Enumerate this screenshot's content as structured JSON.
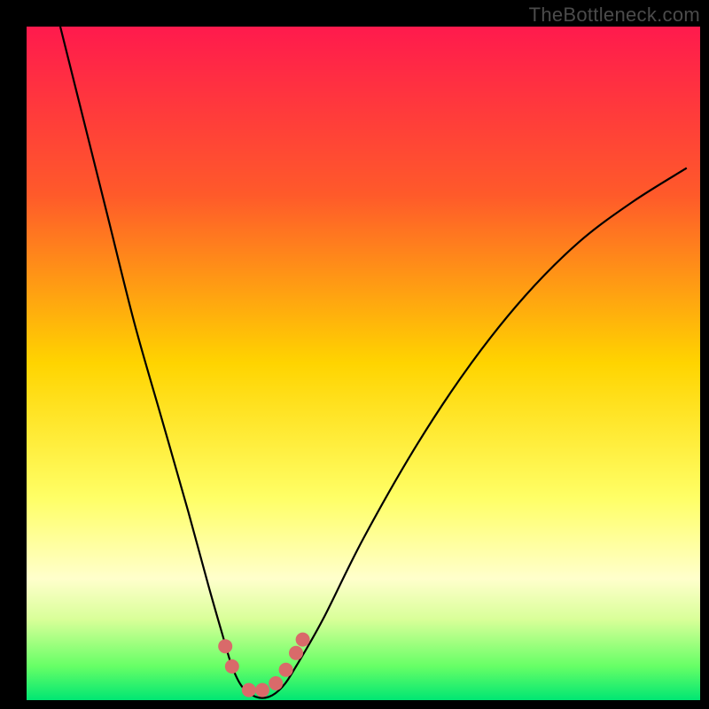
{
  "watermark": "TheBottleneck.com",
  "chart_data": {
    "type": "line",
    "title": "",
    "xlabel": "",
    "ylabel": "",
    "xlim": [
      0,
      100
    ],
    "ylim": [
      0,
      100
    ],
    "gradient_stops": [
      {
        "offset": 0,
        "color": "#ff1a4d"
      },
      {
        "offset": 25,
        "color": "#ff5a2a"
      },
      {
        "offset": 50,
        "color": "#ffd400"
      },
      {
        "offset": 70,
        "color": "#ffff66"
      },
      {
        "offset": 82,
        "color": "#ffffcc"
      },
      {
        "offset": 88,
        "color": "#d9ff99"
      },
      {
        "offset": 95,
        "color": "#66ff66"
      },
      {
        "offset": 100,
        "color": "#00e673"
      }
    ],
    "series": [
      {
        "name": "bottleneck-curve",
        "x": [
          5,
          8,
          12,
          16,
          20,
          24,
          27,
          29,
          30.5,
          32,
          34,
          36,
          38,
          40,
          44,
          50,
          58,
          66,
          74,
          82,
          90,
          98
        ],
        "y": [
          100,
          88,
          72,
          56,
          42,
          28,
          17,
          10,
          5,
          2,
          0.5,
          0.5,
          2,
          5,
          12,
          24,
          38,
          50,
          60,
          68,
          74,
          79
        ]
      }
    ],
    "markers": {
      "name": "highlight-points",
      "color": "#d96a6a",
      "radius": 8,
      "points": [
        {
          "x": 29.5,
          "y": 8
        },
        {
          "x": 30.5,
          "y": 5
        },
        {
          "x": 33,
          "y": 1.5
        },
        {
          "x": 35,
          "y": 1.5
        },
        {
          "x": 37,
          "y": 2.5
        },
        {
          "x": 38.5,
          "y": 4.5
        },
        {
          "x": 40,
          "y": 7
        },
        {
          "x": 41,
          "y": 9
        }
      ]
    }
  }
}
